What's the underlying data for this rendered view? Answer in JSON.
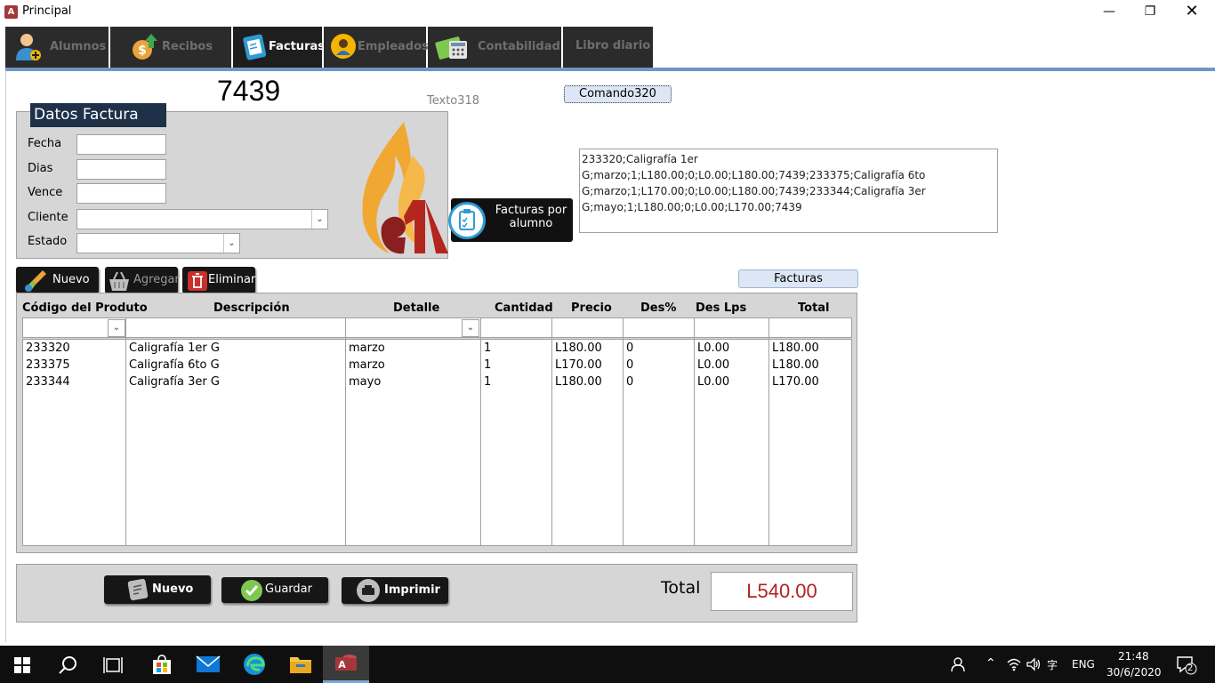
{
  "window": {
    "title": "Principal",
    "app_icon_letter": "A"
  },
  "tabs": [
    {
      "label": "Alumnos",
      "icon": "student-add-icon",
      "active": false
    },
    {
      "label": "Recibos",
      "icon": "coin-up-icon",
      "active": false
    },
    {
      "label": "Facturas",
      "icon": "invoice-icon",
      "active": true
    },
    {
      "label": "Empleados",
      "icon": "employee-icon",
      "active": false
    },
    {
      "label": "Contabilidad",
      "icon": "calculator-money-icon",
      "active": false
    },
    {
      "label": "Libro diario",
      "icon": "",
      "active": false
    }
  ],
  "invoice_number": "7439",
  "texto318": "Texto318",
  "comando320": "Comando320",
  "datos_factura": {
    "title": "Datos Factura",
    "fields": {
      "fecha": {
        "label": "Fecha",
        "value": ""
      },
      "dias": {
        "label": "Dias",
        "value": ""
      },
      "vence": {
        "label": "Vence",
        "value": ""
      },
      "cliente": {
        "label": "Cliente",
        "value": ""
      },
      "estado": {
        "label": "Estado",
        "value": ""
      }
    }
  },
  "facturas_por_alumno": "Facturas por alumno",
  "concat_text": "233320;Caligrafía 1er G;marzo;1;L180.00;0;L0.00;L180.00;7439;233375;Caligrafía 6to G;marzo;1;L170.00;0;L0.00;L180.00;7439;233344;Caligrafía 3er G;mayo;1;L180.00;0;L0.00;L170.00;7439",
  "toolbar": {
    "nuevo": "Nuevo",
    "agregar": "Agregar",
    "eliminar": "Eliminar",
    "facturas": "Facturas"
  },
  "grid": {
    "columns": [
      "Código del Produto",
      "Descripción",
      "Detalle",
      "Cantidad",
      "Precio",
      "Des%",
      "Des Lps",
      "Total"
    ],
    "rows": [
      [
        "233320",
        "Caligrafía 1er G",
        "marzo",
        "1",
        "L180.00",
        "0",
        "L0.00",
        "L180.00"
      ],
      [
        "233375",
        "Caligrafía 6to G",
        "marzo",
        "1",
        "L170.00",
        "0",
        "L0.00",
        "L180.00"
      ],
      [
        "233344",
        "Caligrafía 3er G",
        "mayo",
        "1",
        "L180.00",
        "0",
        "L0.00",
        "L170.00"
      ]
    ]
  },
  "footer": {
    "nuevo": "Nuevo",
    "guardar": "Guardar",
    "imprimir": "Imprimir",
    "total_label": "Total",
    "total_value": "L540.00"
  },
  "taskbar": {
    "language": "ENG",
    "time": "21:48",
    "date": "30/6/2020",
    "notification_count": "2"
  }
}
